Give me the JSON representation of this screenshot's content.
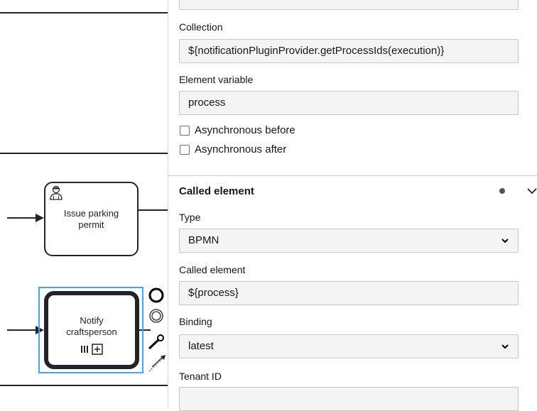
{
  "canvas": {
    "tasks": [
      {
        "id": "issue",
        "label_line1": "Issue parking",
        "label_line2": "permit",
        "icon": "user-icon"
      },
      {
        "id": "notify",
        "label_line1": "Notify",
        "label_line2": "craftsperson",
        "markers": [
          "parallel-multi-instance-icon",
          "collapsed-subprocess-icon"
        ]
      }
    ]
  },
  "panel": {
    "collection": {
      "label": "Collection",
      "value": "${notificationPluginProvider.getProcessIds(execution)}"
    },
    "element_variable": {
      "label": "Element variable",
      "value": "process"
    },
    "async_before": {
      "label": "Asynchronous before",
      "checked": false
    },
    "async_after": {
      "label": "Asynchronous after",
      "checked": false
    },
    "called_element_section": {
      "title": "Called element",
      "type": {
        "label": "Type",
        "value": "BPMN"
      },
      "called_element": {
        "label": "Called element",
        "value": "${process}"
      },
      "binding": {
        "label": "Binding",
        "value": "latest"
      },
      "tenant_id": {
        "label": "Tenant ID",
        "value": ""
      }
    }
  },
  "colors": {
    "selection": "#3ea6ff",
    "field_bg": "#f4f4f4",
    "stroke": "#22242a"
  }
}
